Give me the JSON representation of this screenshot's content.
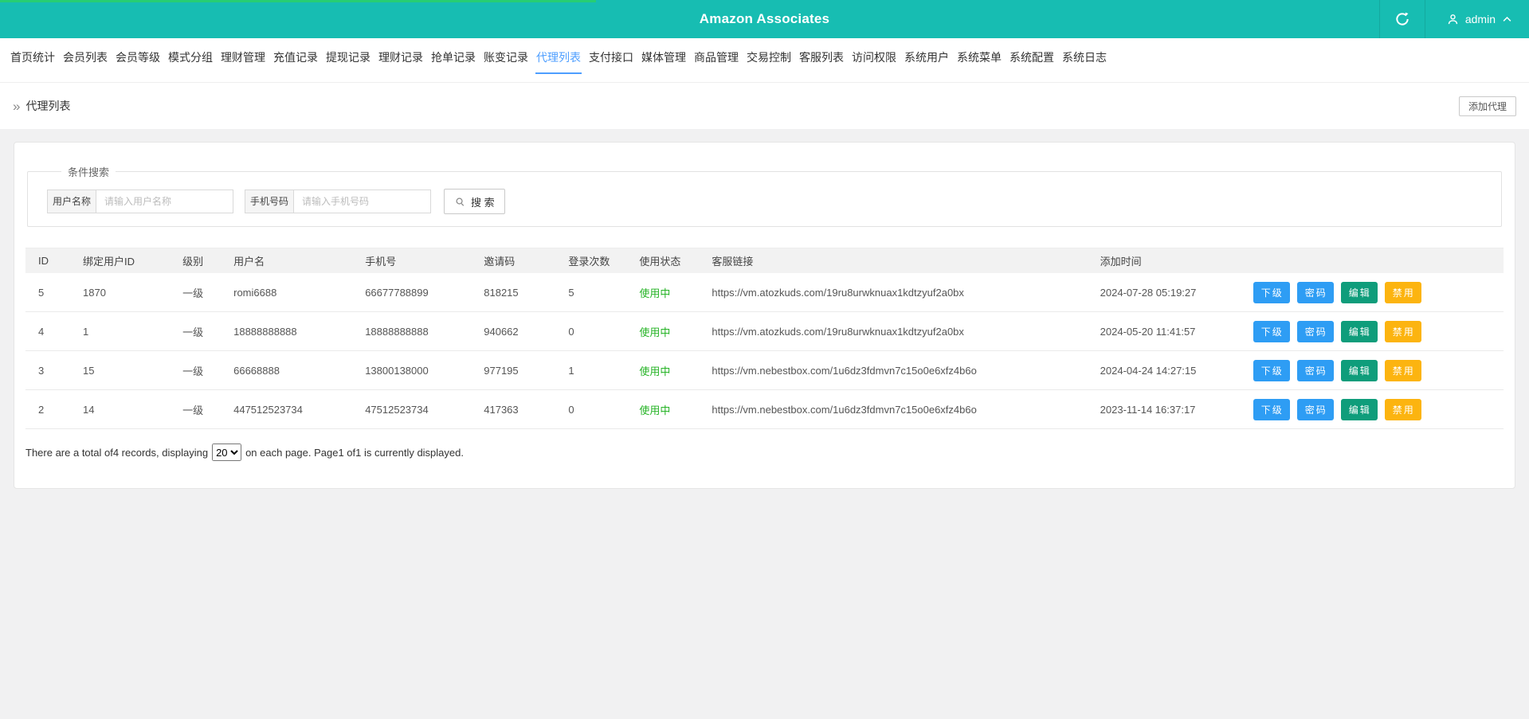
{
  "header": {
    "title": "Amazon Associates",
    "admin": "admin",
    "bar_color": "#17bdb2",
    "progress_color": "#27cd73"
  },
  "nav": {
    "active_color": "#4d9eff",
    "items": [
      {
        "label": "首页统计",
        "active": false
      },
      {
        "label": "会员列表",
        "active": false
      },
      {
        "label": "会员等级",
        "active": false
      },
      {
        "label": "模式分组",
        "active": false
      },
      {
        "label": "理财管理",
        "active": false
      },
      {
        "label": "充值记录",
        "active": false
      },
      {
        "label": "提现记录",
        "active": false
      },
      {
        "label": "理财记录",
        "active": false
      },
      {
        "label": "抢单记录",
        "active": false
      },
      {
        "label": "账变记录",
        "active": false
      },
      {
        "label": "代理列表",
        "active": true
      },
      {
        "label": "支付接口",
        "active": false
      },
      {
        "label": "媒体管理",
        "active": false
      },
      {
        "label": "商品管理",
        "active": false
      },
      {
        "label": "交易控制",
        "active": false
      },
      {
        "label": "客服列表",
        "active": false
      },
      {
        "label": "访问权限",
        "active": false
      },
      {
        "label": "系统用户",
        "active": false
      },
      {
        "label": "系统菜单",
        "active": false
      },
      {
        "label": "系统配置",
        "active": false
      },
      {
        "label": "系统日志",
        "active": false
      }
    ]
  },
  "breadcrumb": {
    "arrow": "»",
    "label": "代理列表",
    "add_button": "添加代理"
  },
  "search": {
    "legend": "条件搜索",
    "fields": [
      {
        "label": "用户名称",
        "placeholder": "请输入用户名称",
        "value": ""
      },
      {
        "label": "手机号码",
        "placeholder": "请输入手机号码",
        "value": ""
      }
    ],
    "button_label": "搜 索"
  },
  "table": {
    "columns": [
      "ID",
      "绑定用户ID",
      "级别",
      "用户名",
      "手机号",
      "邀请码",
      "登录次数",
      "使用状态",
      "客服链接",
      "添加时间",
      ""
    ],
    "status_color": "#25b325",
    "actions": [
      {
        "name": "subordinates",
        "label": "下级",
        "color": "#2e9df4"
      },
      {
        "name": "password",
        "label": "密码",
        "color": "#2e9df4"
      },
      {
        "name": "edit",
        "label": "编辑",
        "color": "#0f9d7b"
      },
      {
        "name": "disable",
        "label": "禁用",
        "color": "#fcb410"
      }
    ],
    "rows": [
      {
        "id": "5",
        "bind_user_id": "1870",
        "level": "一级",
        "username": "romi6688",
        "phone": "66677788899",
        "invite_code": "818215",
        "login_count": "5",
        "status": "使用中",
        "service_link": "https://vm.atozkuds.com/19ru8urwknuax1kdtzyuf2a0bx",
        "created_at": "2024-07-28 05:19:27"
      },
      {
        "id": "4",
        "bind_user_id": "1",
        "level": "一级",
        "username": "18888888888",
        "phone": "18888888888",
        "invite_code": "940662",
        "login_count": "0",
        "status": "使用中",
        "service_link": "https://vm.atozkuds.com/19ru8urwknuax1kdtzyuf2a0bx",
        "created_at": "2024-05-20 11:41:57"
      },
      {
        "id": "3",
        "bind_user_id": "15",
        "level": "一级",
        "username": "66668888",
        "phone": "13800138000",
        "invite_code": "977195",
        "login_count": "1",
        "status": "使用中",
        "service_link": "https://vm.nebestbox.com/1u6dz3fdmvn7c15o0e6xfz4b6o",
        "created_at": "2024-04-24 14:27:15"
      },
      {
        "id": "2",
        "bind_user_id": "14",
        "level": "一级",
        "username": "447512523734",
        "phone": "47512523734",
        "invite_code": "417363",
        "login_count": "0",
        "status": "使用中",
        "service_link": "https://vm.nebestbox.com/1u6dz3fdmvn7c15o0e6xfz4b6o",
        "created_at": "2023-11-14 16:37:17"
      }
    ]
  },
  "pagination": {
    "text_before": "There are a total of4 records, displaying",
    "page_size": "20",
    "text_after": "on each page. Page1 of1 is currently displayed."
  },
  "icons": {
    "refresh": "circular-arrow",
    "user": "person-outline",
    "caret": "chevron-up",
    "search": "magnifier",
    "breadcrumb_arrow": "double-angle-right"
  }
}
